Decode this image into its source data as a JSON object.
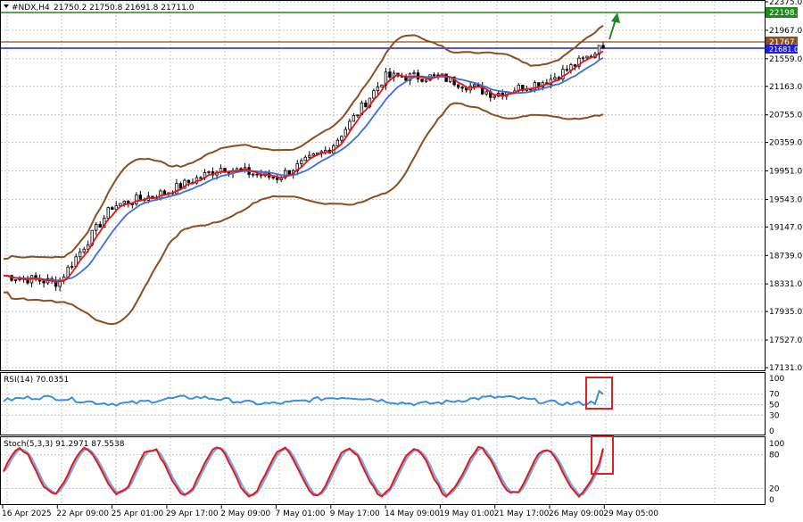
{
  "header": {
    "symbol": "#NDX,H4",
    "ohlc": "21750.2 21750.8 21691.8 21711.0"
  },
  "colors": {
    "bullish_candle": "#000000",
    "bearish_candle": "#000000",
    "fast_ma": "#e8131b",
    "slow_ma": "#3a6fd8",
    "bollinger": "#8b4f1e",
    "resistance_line": "#1f8a1f",
    "level_line": "#1f1fd0",
    "rsi_line": "#3a8ee0",
    "stoch_main": "#e01919",
    "stoch_signal": "#7aa7e8",
    "highlight_box": "#e02020",
    "arrow": "#1f8a1f",
    "price_tag_green": "#1f8a1f",
    "price_tag_brown": "#8b4f1e",
    "price_tag_blue": "#1f1fd0"
  },
  "price_panel": {
    "y_ticks": [
      "22375.0",
      "21967.0",
      "21559.0",
      "21163.0",
      "20755.0",
      "20359.0",
      "19951.0",
      "19543.0",
      "19147.0",
      "18739.0",
      "18331.0",
      "17935.0",
      "17527.0",
      "17131.0"
    ],
    "price_tags": {
      "resistance": "22198.0",
      "upper": "21767.5",
      "current": "21681.0"
    }
  },
  "rsi_panel": {
    "label": "RSI(14) 70.0351",
    "y_ticks": [
      "100",
      "70",
      "50",
      "30",
      "0"
    ]
  },
  "stoch_panel": {
    "label": "Stoch(5,3,3) 91.2971 87.5538",
    "y_ticks": [
      "100",
      "80",
      "20",
      "0"
    ]
  },
  "x_axis": {
    "labels": [
      "16 Apr 2025",
      "22 Apr 09:00",
      "25 Apr 01:00",
      "29 Apr 17:00",
      "2 May 09:00",
      "7 May 01:00",
      "9 May 17:00",
      "14 May 09:00",
      "19 May 01:00",
      "21 May 17:00",
      "26 May 09:00",
      "29 May 05:00"
    ]
  },
  "chart_data": {
    "type": "line",
    "title": "#NDX,H4",
    "x": [
      "16 Apr 2025",
      "22 Apr 09:00",
      "25 Apr 01:00",
      "29 Apr 17:00",
      "2 May 09:00",
      "7 May 01:00",
      "9 May 17:00",
      "14 May 09:00",
      "19 May 01:00",
      "21 May 17:00",
      "26 May 09:00",
      "29 May 05:00"
    ],
    "series": [
      {
        "values": [
          18450,
          18350,
          19450,
          19650,
          20000,
          19850,
          20280,
          21300,
          21300,
          21050,
          21250,
          21711
        ]
      }
    ],
    "ylim": [
      17131,
      22375
    ],
    "grid": true,
    "levels": [
      22198.0,
      21767.5,
      21681.0
    ],
    "rsi": {
      "name": "RSI(14)",
      "last": 70.0351,
      "ylim": [
        0,
        100
      ],
      "levels": [
        70,
        50,
        30
      ]
    },
    "stochastic": {
      "name": "Stoch(5,3,3)",
      "main": 91.2971,
      "signal": 87.5538,
      "ylim": [
        0,
        100
      ],
      "levels": [
        80,
        20
      ]
    }
  }
}
